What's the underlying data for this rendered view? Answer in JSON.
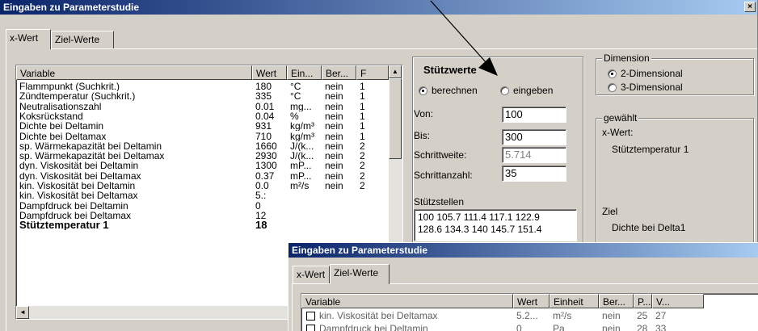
{
  "main_window": {
    "title": "Eingaben zu Parameterstudie",
    "close_glyph": "×",
    "tabs": [
      {
        "label": "x-Wert",
        "active": true
      },
      {
        "label": "Ziel-Werte",
        "active": false
      }
    ],
    "table": {
      "headers": [
        "Variable",
        "Wert",
        "Ein...",
        "Ber...",
        "F"
      ],
      "rows": [
        {
          "variable": "Flammpunkt (Suchkrit.)",
          "wert": "180",
          "einheit": "°C",
          "ber": "nein",
          "f": "1"
        },
        {
          "variable": "Zündtemperatur (Suchkrit.)",
          "wert": "335",
          "einheit": "°C",
          "ber": "nein",
          "f": "1"
        },
        {
          "variable": "Neutralisationszahl",
          "wert": "0.01",
          "einheit": "mg...",
          "ber": "nein",
          "f": "1"
        },
        {
          "variable": "Koksrückstand",
          "wert": "0.04",
          "einheit": "%",
          "ber": "nein",
          "f": "1"
        },
        {
          "variable": "Dichte bei Deltamin",
          "wert": "931",
          "einheit": "kg/m³",
          "ber": "nein",
          "f": "1"
        },
        {
          "variable": "Dichte bei Deltamax",
          "wert": "710",
          "einheit": "kg/m³",
          "ber": "nein",
          "f": "1"
        },
        {
          "variable": "sp. Wärmekapazität bei Deltamin",
          "wert": "1660",
          "einheit": "J/(k...",
          "ber": "nein",
          "f": "2"
        },
        {
          "variable": "sp. Wärmekapazität bei Deltamax",
          "wert": "2930",
          "einheit": "J/(k...",
          "ber": "nein",
          "f": "2"
        },
        {
          "variable": "dyn. Viskosität bei Deltamin",
          "wert": "1300",
          "einheit": "mP...",
          "ber": "nein",
          "f": "2"
        },
        {
          "variable": "dyn. Viskosität bei Deltamax",
          "wert": "0.37",
          "einheit": "mP...",
          "ber": "nein",
          "f": "2"
        },
        {
          "variable": "kin. Viskosität bei Deltamin",
          "wert": "0.0",
          "einheit": "m²/s",
          "ber": "nein",
          "f": "2"
        },
        {
          "variable": "kin. Viskosität bei Deltamax",
          "wert": "5.:",
          "einheit": "",
          "ber": "",
          "f": ""
        },
        {
          "variable": "Dampfdruck bei Deltamin",
          "wert": "0",
          "einheit": "",
          "ber": "",
          "f": ""
        },
        {
          "variable": "Dampfdruck bei Deltamax",
          "wert": "12",
          "einheit": "",
          "ber": "",
          "f": ""
        },
        {
          "variable": "Stütztemperatur 1",
          "wert": "18",
          "einheit": "",
          "ber": "",
          "f": "",
          "bold": true
        }
      ],
      "scroll_up_glyph": "▲",
      "scroll_left_glyph": "◄"
    },
    "stuetzwerte": {
      "title": "Stützwerte",
      "options": [
        {
          "label": "berechnen",
          "selected": true
        },
        {
          "label": "eingeben",
          "selected": false
        }
      ],
      "von_label": "Von:",
      "von_value": "100",
      "bis_label": "Bis:",
      "bis_value": "300",
      "schrittweite_label": "Schrittweite:",
      "schrittweite_value": "5.714",
      "schrittanzahl_label": "Schrittanzahl:",
      "schrittanzahl_value": "35",
      "stuetzstellen_label": "Stützstellen",
      "stuetzstellen_lines": [
        "100 105.7 111.4 117.1 122.9",
        "128.6 134.3 140 145.7 151.4"
      ]
    },
    "dimension": {
      "title": "Dimension",
      "options": [
        {
          "label": "2-Dimensional",
          "selected": true
        },
        {
          "label": "3-Dimensional",
          "selected": false
        }
      ]
    },
    "gewaehlt": {
      "title": "gewählt",
      "xwert_label": "x-Wert:",
      "xwert_value": "Stütztemperatur 1",
      "ziel_label": "Ziel",
      "ziel_value": "Dichte bei Delta1"
    }
  },
  "second_window": {
    "title": "Eingaben zu Parameterstudie",
    "tabs": [
      {
        "label": "x-Wert",
        "active": false
      },
      {
        "label": "Ziel-Werte",
        "active": true
      }
    ],
    "table": {
      "headers": [
        "Variable",
        "Wert",
        "Einheit",
        "Ber...",
        "P...",
        "V..."
      ],
      "rows": [
        {
          "variable": "kin. Viskosität bei Deltamax",
          "wert": "5.2...",
          "einheit": "m²/s",
          "ber": "nein",
          "p": "25",
          "v": "27"
        },
        {
          "variable": "Dampfdruck bei Deltamin",
          "wert": "0",
          "einheit": "Pa",
          "ber": "nein",
          "p": "28",
          "v": "33"
        }
      ]
    }
  },
  "colors": {
    "title_start": "#0a246a",
    "title_end": "#a6caf0",
    "face": "#d4d0c8"
  }
}
